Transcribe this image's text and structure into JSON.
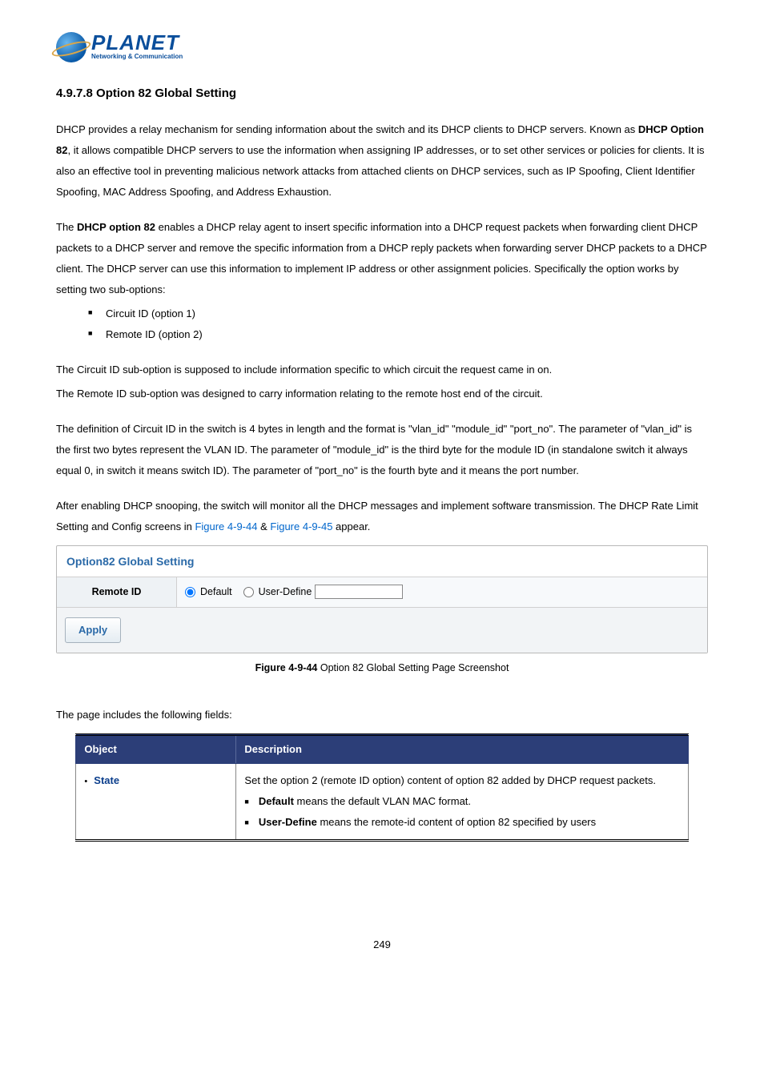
{
  "logo": {
    "main": "PLANET",
    "sub": "Networking & Communication"
  },
  "heading": "4.9.7.8 Option 82 Global Setting",
  "para1_a": "DHCP provides a relay mechanism for sending information about the switch and its DHCP clients to DHCP servers. Known as ",
  "para1_b": "DHCP Option 82",
  "para1_c": ", it allows compatible DHCP servers to use the information when assigning IP addresses, or to set other services or policies for clients. It is also an effective tool in preventing malicious network attacks from attached clients on DHCP services, such as IP Spoofing, Client Identifier Spoofing, MAC Address Spoofing, and Address Exhaustion.",
  "para2_a": "The ",
  "para2_b": "DHCP option 82",
  "para2_c": " enables a DHCP relay agent to insert specific information into a DHCP request packets when forwarding client DHCP packets to a DHCP server and remove the specific information from a DHCP reply packets when forwarding server DHCP packets to a DHCP client. The DHCP server can use this information to implement IP address or other assignment policies. Specifically the option works by setting two sub-options:",
  "bullets": {
    "0": "Circuit ID (option 1)",
    "1": "Remote ID (option 2)"
  },
  "para3": "The Circuit ID sub-option is supposed to include information specific to which circuit the request came in on.",
  "para4": "The Remote ID sub-option was designed to carry information relating to the remote host end of the circuit.",
  "para5": "The definition of Circuit ID in the switch is 4 bytes in length and the format is \"vlan_id\" \"module_id\" \"port_no\". The parameter of \"vlan_id\" is the first two bytes represent the VLAN ID. The parameter of \"module_id\" is the third byte for the module ID (in standalone switch it always equal 0, in switch it means switch ID). The parameter of \"port_no\" is the fourth byte and it means the port number.",
  "para6_a": "After enabling DHCP snooping, the switch will monitor all the DHCP messages and implement software transmission. The DHCP Rate Limit Setting and Config screens in ",
  "para6_link1": "Figure 4-9-44",
  "para6_mid": " & ",
  "para6_link2": "Figure 4-9-45",
  "para6_end": " appear.",
  "figure": {
    "title": "Option82 Global Setting",
    "row_label": "Remote ID",
    "radio_default": "Default",
    "radio_user": "User-Define",
    "apply": "Apply"
  },
  "caption_a": "Figure 4-9-44",
  "caption_b": " Option 82 Global Setting Page Screenshot",
  "fields_intro": "The page includes the following fields:",
  "table": {
    "h1": "Object",
    "h2": "Description",
    "obj1": "State",
    "desc1_line1": "Set the option 2 (remote ID option) content of option 82 added by DHCP request packets.",
    "desc1_b1_bold": "Default",
    "desc1_b1_rest": " means the default VLAN MAC format.",
    "desc1_b2_bold": "User-Define",
    "desc1_b2_rest": " means the remote-id content of option 82 specified by users"
  },
  "page_number": "249"
}
